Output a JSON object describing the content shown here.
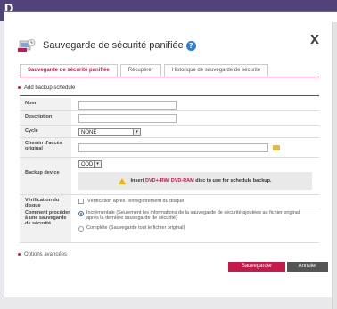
{
  "badge": "D",
  "dialog": {
    "title": "Sauvegarde de sécurité panifiée",
    "close": "X"
  },
  "tabs": [
    {
      "label": "Sauvegarde de sécurité panifiée"
    },
    {
      "label": "Récupérer"
    },
    {
      "label": "Historique de sauvegarde de sécurité"
    }
  ],
  "section": {
    "title": "Add backup schedule"
  },
  "form": {
    "name_label": "Nom",
    "description_label": "Description",
    "cycle_label": "Cycle",
    "cycle_value": "NONE",
    "path_label": "Chemin d'accès original",
    "device_label": "Backup device",
    "device_value": "ODD",
    "warn_prefix": "Insert ",
    "warn_highlight": "DVD+-RW/ DVD-RAM",
    "warn_suffix": " disc to use for schedule backup.",
    "verify_label": "Vérification du disque",
    "verify_text": "Vérification après l'enregistrement du disque",
    "method_label": "Comment procéder à une sauvegarde de sécurité",
    "method_incremental": "Incrémentale (Seulement les informations de la sauvegarde de sécurité ajoutées au fichier original après la dernière sauvegarde de sécurité)",
    "method_complete": "Complète (Sauvegarde tout le fichier original)"
  },
  "advanced": "Options avancées",
  "buttons": {
    "save": "Sauvegarder",
    "cancel": "Annuler"
  }
}
